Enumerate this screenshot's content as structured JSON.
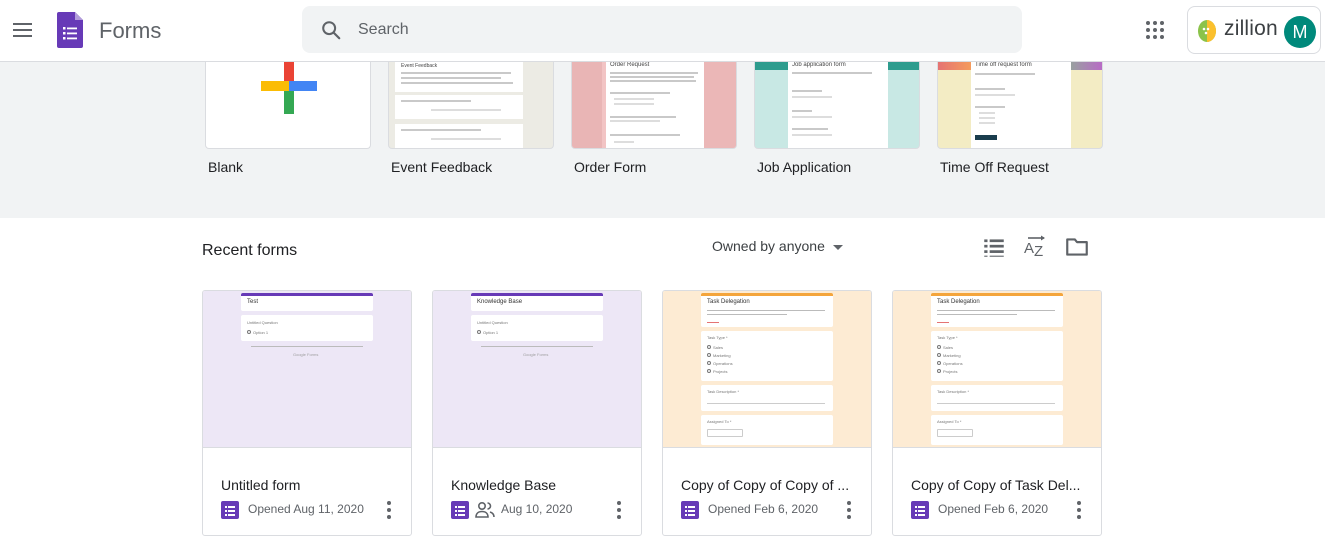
{
  "header": {
    "app_title": "Forms",
    "search_placeholder": "Search",
    "account_brand": "zillion",
    "avatar_initial": "M"
  },
  "templates": [
    {
      "label": "Blank",
      "thumb_title": ""
    },
    {
      "label": "Event Feedback",
      "thumb_title": "Event Feedback"
    },
    {
      "label": "Order Form",
      "thumb_title": "Order Request"
    },
    {
      "label": "Job Application",
      "thumb_title": "Job application form"
    },
    {
      "label": "Time Off Request",
      "thumb_title": "Time off request form"
    }
  ],
  "recent": {
    "title": "Recent forms",
    "owner_filter": "Owned by anyone",
    "cards": [
      {
        "title": "Untitled form",
        "date": "Opened Aug 11, 2020",
        "thumb_title": "Test",
        "thumb_question": "Untitled Question",
        "thumb_option": "Option 1",
        "footer": "Google Forms",
        "shared": false
      },
      {
        "title": "Knowledge Base",
        "date": "Aug 10, 2020",
        "thumb_title": "Knowledge Base",
        "thumb_question": "Untitled Question",
        "thumb_option": "Option 1",
        "footer": "Google Forms",
        "shared": true
      },
      {
        "title": "Copy of Copy of Copy of ...",
        "date": "Opened Feb 6, 2020",
        "thumb_title": "Task Delegation",
        "thumb_q1": "Task Type *",
        "thumb_q2": "Task Description *",
        "thumb_q3": "Assigned To *",
        "thumb_options": [
          "Sales",
          "Marketing",
          "Operations",
          "Projects"
        ],
        "shared": false
      },
      {
        "title": "Copy of Copy of Task Del...",
        "date": "Opened Feb 6, 2020",
        "thumb_title": "Task Delegation",
        "thumb_q1": "Task Type *",
        "thumb_q2": "Task Description *",
        "thumb_q3": "Assigned To *",
        "thumb_options": [
          "Sales",
          "Marketing",
          "Operations",
          "Projects"
        ],
        "shared": false
      }
    ]
  },
  "icons": {
    "menu": "hamburger-menu-icon",
    "search": "search-icon",
    "apps": "apps-grid-icon",
    "list_view": "list-view-icon",
    "sort": "sort-az-icon",
    "folder": "folder-icon",
    "more": "more-vert-icon",
    "shared": "people-icon"
  },
  "colors": {
    "forms_purple": "#673ab7",
    "avatar": "#00897b",
    "gallery_bg": "#f1f3f4"
  }
}
